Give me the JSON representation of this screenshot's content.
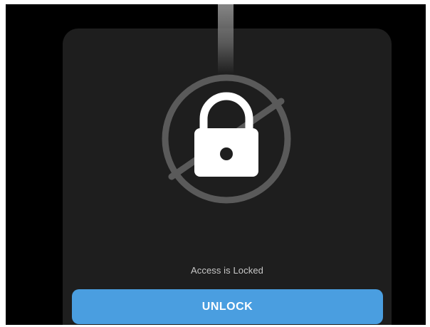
{
  "lock_screen": {
    "status_text": "Access is Locked",
    "unlock_label": "UNLOCK",
    "icon": "locked-padlock-prohibited-icon"
  },
  "colors": {
    "screen_background": "#000000",
    "card_background": "#1e1e1e",
    "prohibit_ring": "#5a5a5a",
    "padlock": "#ffffff",
    "status_text": "#c9c9c9",
    "button_accent": "#4a9ee0"
  }
}
